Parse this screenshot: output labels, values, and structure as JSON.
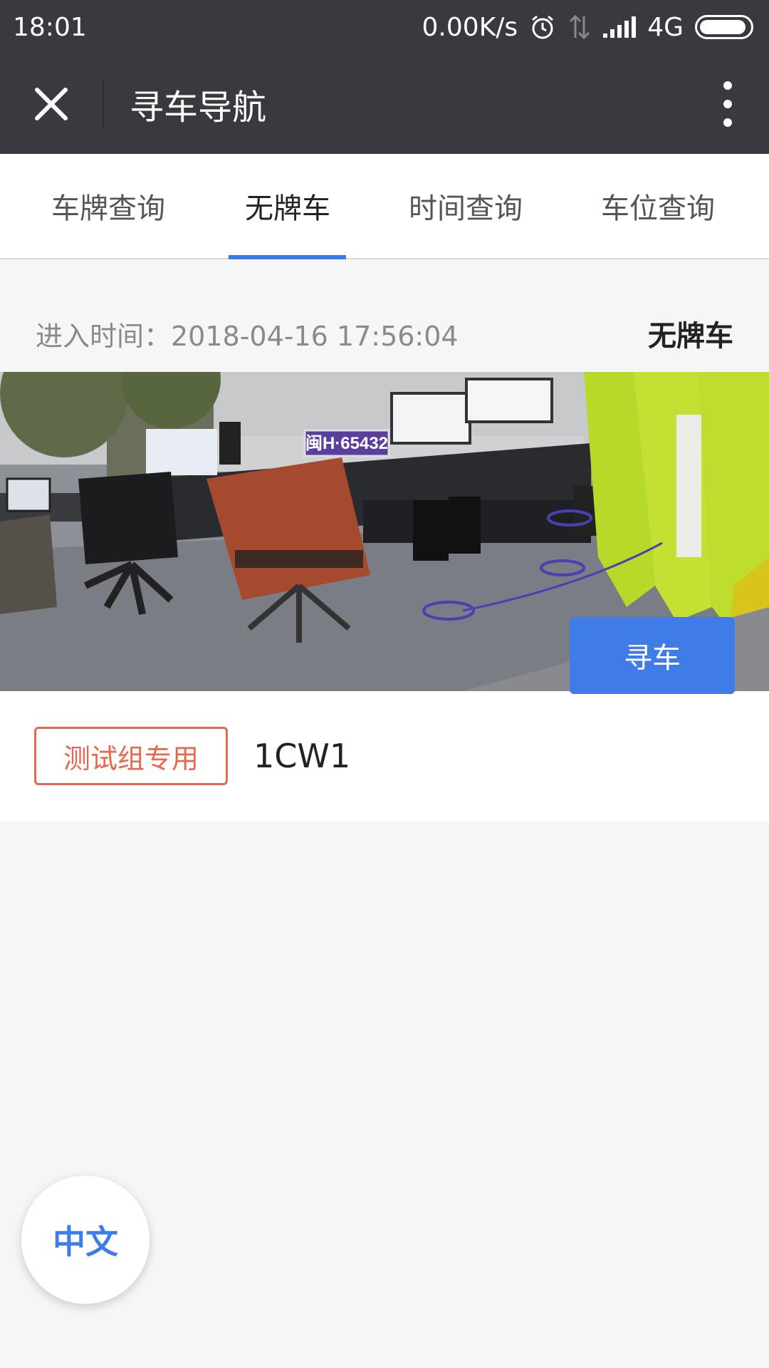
{
  "status_bar": {
    "time": "18:01",
    "net_speed": "0.00K/s",
    "network": "4G",
    "icons": [
      "alarm-icon",
      "data-arrows-icon",
      "signal-icon",
      "battery-icon"
    ]
  },
  "nav": {
    "title": "寻车导航",
    "close_icon": "close-icon",
    "more_icon": "more-vertical-icon"
  },
  "tabs": [
    {
      "label": "车牌查询",
      "active": false
    },
    {
      "label": "无牌车",
      "active": true
    },
    {
      "label": "时间查询",
      "active": false
    },
    {
      "label": "车位查询",
      "active": false
    }
  ],
  "record": {
    "entry_time": "进入时间：2018-04-16 17:56:04",
    "plate_type": "无牌车",
    "snapshot_plate_text": "闽H·65432",
    "group_tag": "测试组专用",
    "plate_number": "1CW1",
    "find_button": "寻车"
  },
  "language_button": "中文",
  "colors": {
    "header_bg": "#393a3f",
    "accent": "#3f7ce8",
    "tag": "#e8674f",
    "page_bg": "#f6f6f7"
  }
}
